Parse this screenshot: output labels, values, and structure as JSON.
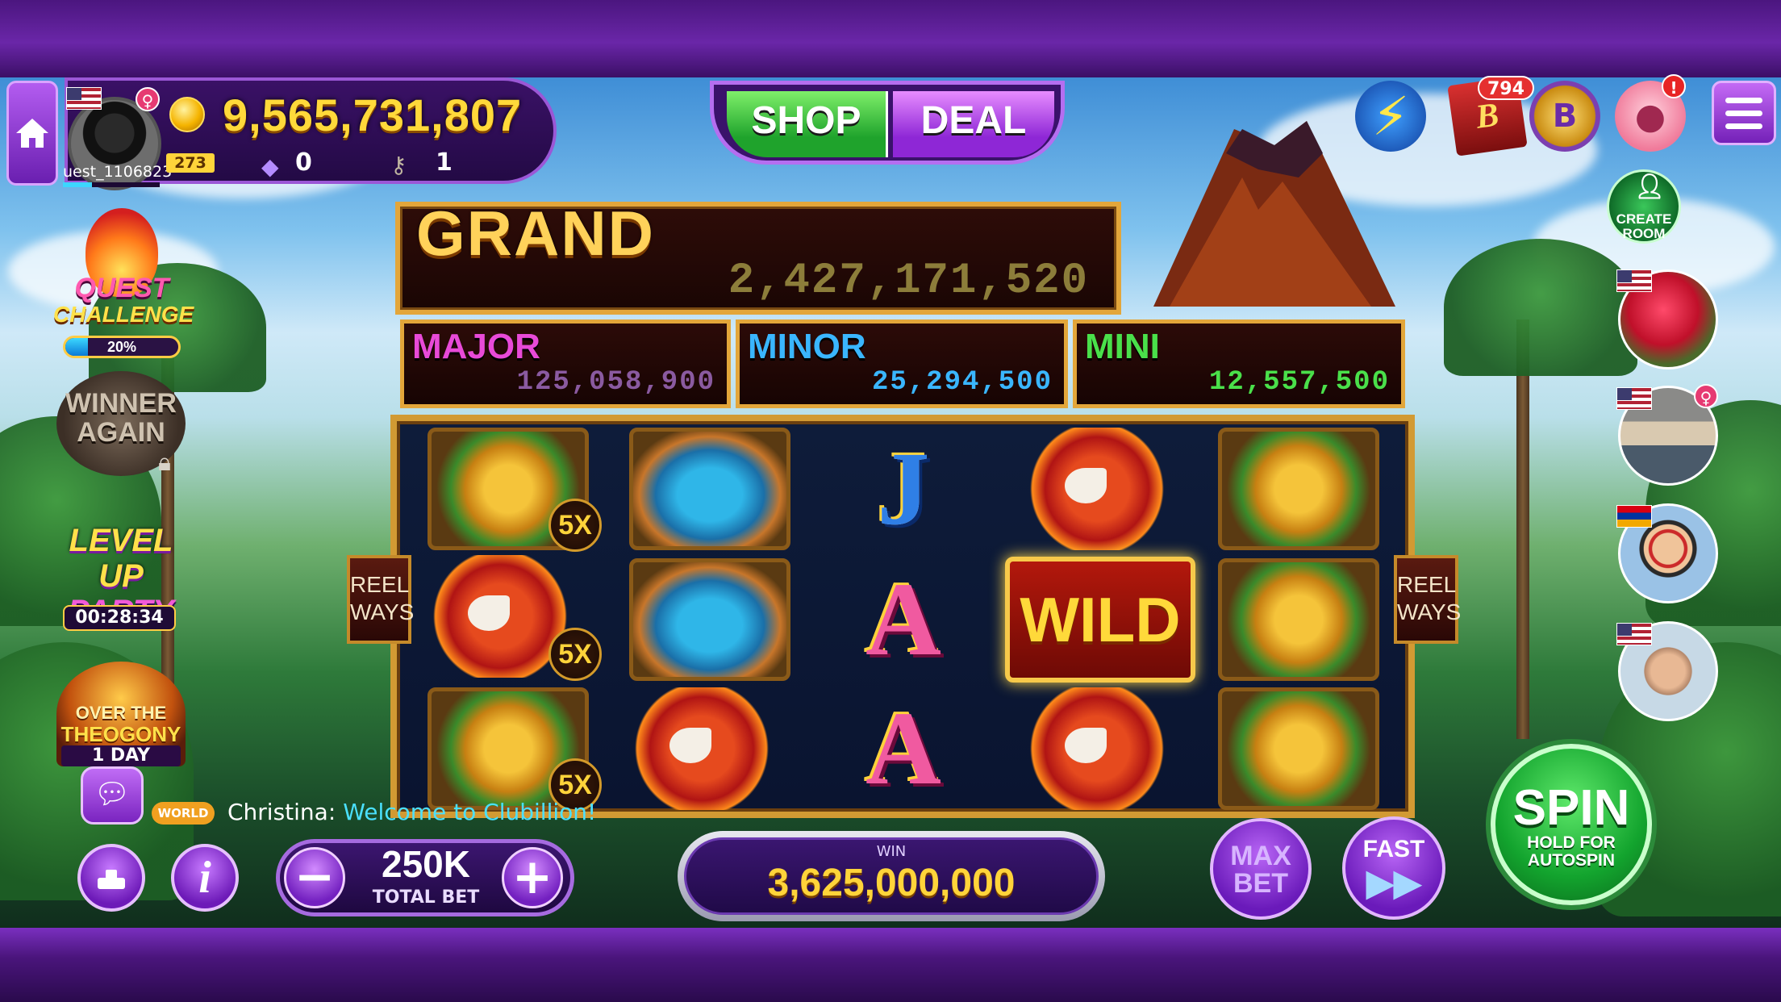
{
  "player": {
    "username": "uest_1106823",
    "balance": "9,565,731,807",
    "level": "273",
    "gems": "0",
    "keys": "1"
  },
  "header": {
    "shop_label": "SHOP",
    "deal_label": "DEAL",
    "album_badge": "794",
    "piggy_badge": "!",
    "book_glyph": "B",
    "medal_glyph": "B"
  },
  "events": {
    "quest_line1": "QUEST",
    "quest_line2": "CHALLENGE",
    "quest_progress": "20%",
    "quest_progress_value": 0.2,
    "winner_line1": "WINNER",
    "winner_line2": "AGAIN",
    "levelup_line1": "LEVEL UP",
    "levelup_line2": "PARTY",
    "levelup_timer": "00:28:34",
    "theogony_line1": "OVER THE",
    "theogony_line2": "THEOGONY",
    "theogony_days": "1 DAY"
  },
  "jackpots": {
    "grand_label": "GRAND",
    "grand_value": "2,427,171,520",
    "major_label": "MAJOR",
    "major_value": "125,058,900",
    "minor_label": "MINOR",
    "minor_value": "25,294,500",
    "mini_label": "MINI",
    "mini_value": "12,557,500"
  },
  "reels": {
    "reel_ways_label_1": "REEL",
    "reel_ways_label_2": "WAYS",
    "multiplier": "5X",
    "letter_j": "J",
    "letter_a": "A",
    "wild_label": "WILD",
    "grid": [
      [
        "tiki-green",
        "parrot",
        "tiki-green"
      ],
      [
        "tiki-blue",
        "tiki-blue",
        "parrot"
      ],
      [
        "letter-j",
        "letter-a",
        "letter-a"
      ],
      [
        "parrot",
        "wild",
        "parrot"
      ],
      [
        "tiki-green",
        "tiki-green",
        "tiki-green"
      ]
    ]
  },
  "sidebar_right": {
    "create_room_line1": "CREATE",
    "create_room_line2": "ROOM"
  },
  "chat": {
    "channel": "WORLD",
    "sender": "Christina:",
    "message": "Welcome to Clubillion!"
  },
  "controls": {
    "bet_value": "250K",
    "bet_label": "TOTAL BET",
    "minus": "−",
    "plus": "+",
    "info": "i",
    "win_label": "WIN",
    "win_value": "3,625,000,000",
    "maxbet_line1": "MAX",
    "maxbet_line2": "BET",
    "fast_label": "FAST",
    "spin_label": "SPIN",
    "spin_sub1": "HOLD FOR",
    "spin_sub2": "AUTOSPIN"
  },
  "colors": {
    "major": "#e84ad8",
    "minor": "#3ab6ff",
    "mini": "#4ae04a",
    "balance": "#ffd93a"
  }
}
